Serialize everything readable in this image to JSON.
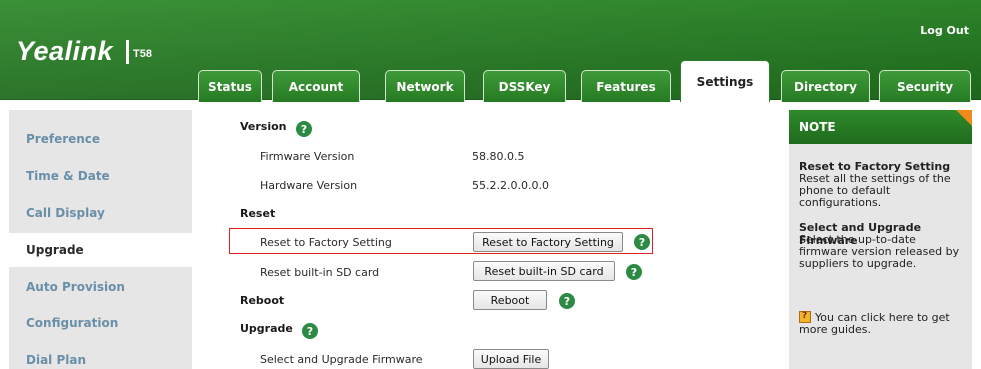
{
  "header": {
    "brand": "Yealink",
    "model": "T58",
    "logout_label": "Log Out"
  },
  "tabs": [
    {
      "label": "Status"
    },
    {
      "label": "Account"
    },
    {
      "label": "Network"
    },
    {
      "label": "DSSKey"
    },
    {
      "label": "Features"
    },
    {
      "label": "Settings",
      "active": true
    },
    {
      "label": "Directory"
    },
    {
      "label": "Security"
    }
  ],
  "sidebar": {
    "items": [
      {
        "label": "Preference"
      },
      {
        "label": "Time & Date"
      },
      {
        "label": "Call Display"
      },
      {
        "label": "Upgrade",
        "active": true
      },
      {
        "label": "Auto Provision"
      },
      {
        "label": "Configuration"
      },
      {
        "label": "Dial Plan"
      }
    ]
  },
  "main": {
    "version": {
      "title": "Version",
      "firmware_label": "Firmware Version",
      "firmware_value": "58.80.0.5",
      "hardware_label": "Hardware Version",
      "hardware_value": "55.2.2.0.0.0.0"
    },
    "reset": {
      "title": "Reset",
      "factory_label": "Reset to Factory Setting",
      "factory_button": "Reset to Factory Setting",
      "sd_label": "Reset built-in SD card",
      "sd_button": "Reset built-in SD card"
    },
    "reboot": {
      "title": "Reboot",
      "button": "Reboot"
    },
    "upgrade": {
      "title": "Upgrade",
      "firmware_label": "Select and Upgrade Firmware",
      "upload_button": "Upload File"
    },
    "help_glyph": "?"
  },
  "note": {
    "header": "NOTE",
    "factory_title": "Reset to Factory Setting",
    "factory_text": "Reset all the settings of the phone to default configurations.",
    "firmware_title": "Select and Upgrade Firmware",
    "firmware_text": "Select the up-to-date firmware version released by suppliers to upgrade.",
    "guide_text": "You can click here to get more guides."
  },
  "colors": {
    "brand_green": "#267a22",
    "highlight_red": "#e02020",
    "help_green": "#2c8a45",
    "link_blue": "#6a8fa8"
  }
}
